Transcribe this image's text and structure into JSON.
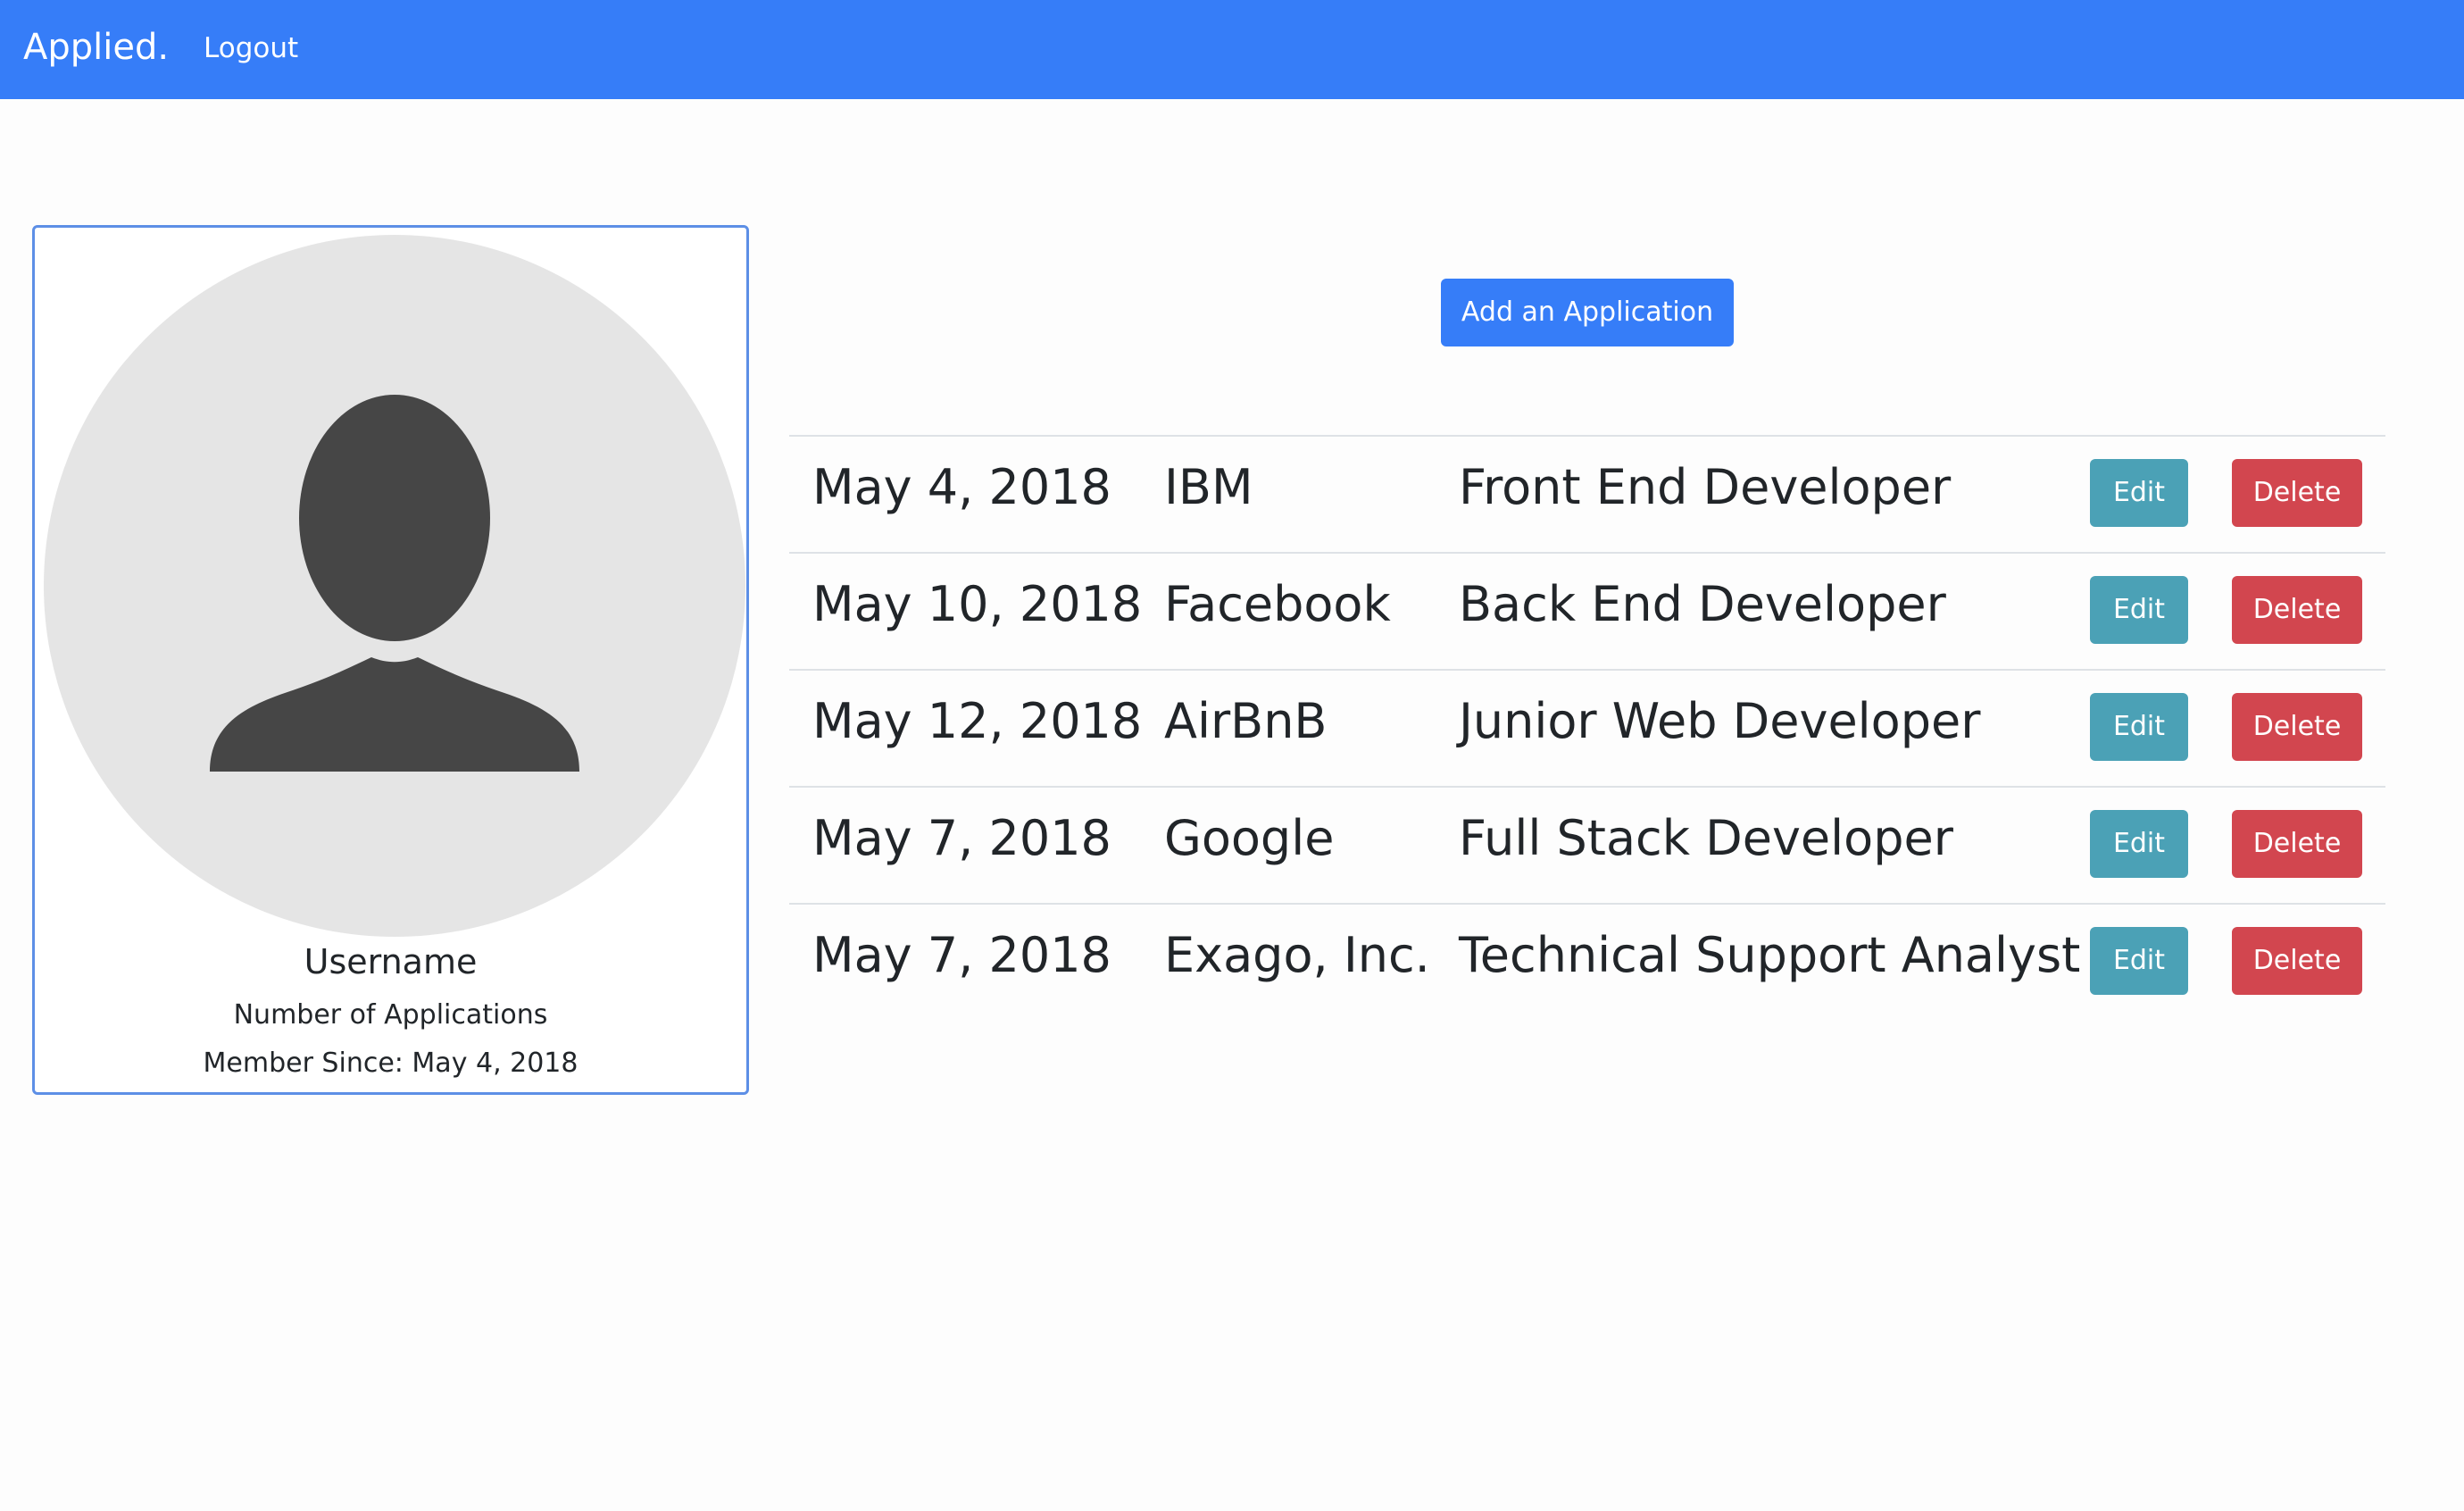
{
  "navbar": {
    "brand": "Applied.",
    "logout_label": "Logout"
  },
  "profile": {
    "username": "Username",
    "applications_label": "Number of Applications",
    "member_since": "Member Since: May 4, 2018"
  },
  "actions": {
    "add_label": "Add an Application"
  },
  "applications": [
    {
      "date": "May 4, 2018",
      "company": "IBM",
      "title": "Front End Developer",
      "edit_label": "Edit",
      "delete_label": "Delete"
    },
    {
      "date": "May 10, 2018",
      "company": "Facebook",
      "title": "Back End Developer",
      "edit_label": "Edit",
      "delete_label": "Delete"
    },
    {
      "date": "May 12, 2018",
      "company": "AirBnB",
      "title": "Junior Web Developer",
      "edit_label": "Edit",
      "delete_label": "Delete"
    },
    {
      "date": "May 7, 2018",
      "company": "Google",
      "title": "Full Stack Developer",
      "edit_label": "Edit",
      "delete_label": "Delete"
    },
    {
      "date": "May 7, 2018",
      "company": "Exago, Inc.",
      "title": "Technical Support Analyst",
      "edit_label": "Edit",
      "delete_label": "Delete"
    }
  ],
  "colors": {
    "primary": "#367df8",
    "edit": "#4ba1b6",
    "delete": "#d2464f",
    "avatar_bg": "#e5e5e5",
    "avatar_fg": "#464646"
  },
  "icons": {
    "avatar": "user-silhouette-icon"
  }
}
